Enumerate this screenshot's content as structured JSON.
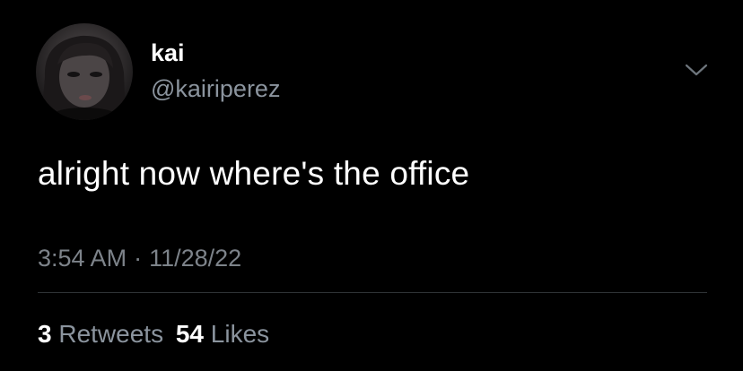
{
  "user": {
    "display_name": "kai",
    "handle": "@kairiperez"
  },
  "tweet": {
    "text": "alright now where's the office",
    "time": "3:54 AM",
    "separator": "·",
    "date": "11/28/22"
  },
  "stats": {
    "retweets_count": "3",
    "retweets_label": "Retweets",
    "likes_count": "54",
    "likes_label": "Likes"
  },
  "icons": {
    "more": "chevron-down-icon"
  },
  "colors": {
    "background": "#000000",
    "primary_text": "#ffffff",
    "secondary_text": "#8b949e",
    "divider": "#2f3336"
  }
}
